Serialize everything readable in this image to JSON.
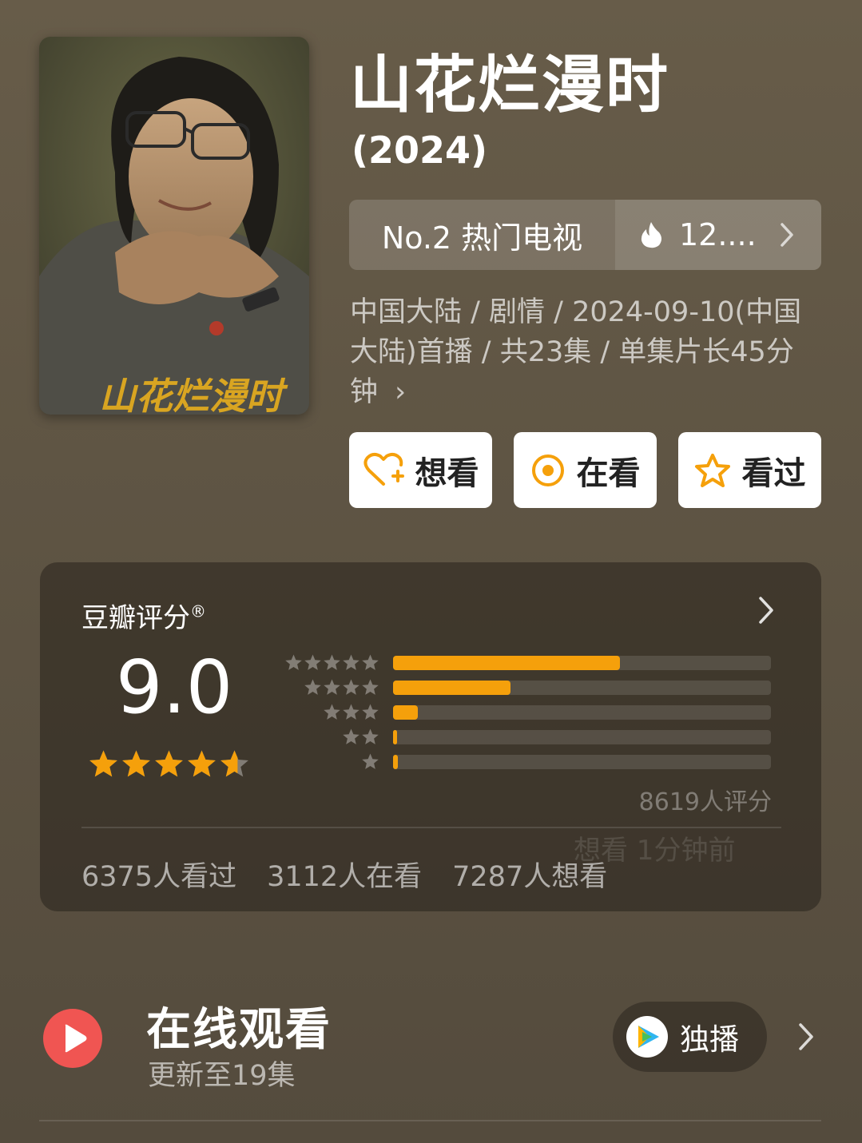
{
  "header": {
    "title": "山花烂漫时",
    "year": "(2024)",
    "poster_title_art": "山花烂漫时"
  },
  "rank": {
    "label": "No.2 热门电视",
    "heat": "12....",
    "flame_icon": "flame-icon",
    "chevron_icon": "chevron-right-icon"
  },
  "meta": {
    "text": "中国大陆 / 剧情 / 2024-09-10(中国大陆)首播 / 共23集 / 单集片长45分钟",
    "chevron": "›"
  },
  "actions": [
    {
      "label": "想看",
      "icon": "heart-plus-icon"
    },
    {
      "label": "在看",
      "icon": "target-icon"
    },
    {
      "label": "看过",
      "icon": "star-outline-icon"
    }
  ],
  "rating": {
    "title": "豆瓣评分",
    "registered": "®",
    "score": "9.0",
    "stars": 4.5,
    "distribution": [
      {
        "stars": 5,
        "fraction": 0.6
      },
      {
        "stars": 4,
        "fraction": 0.31
      },
      {
        "stars": 3,
        "fraction": 0.065
      },
      {
        "stars": 2,
        "fraction": 0.006
      },
      {
        "stars": 1,
        "fraction": 0.012
      }
    ],
    "raters": "8619人评分",
    "stats": [
      "6375人看过",
      "3112人在看",
      "7287人想看"
    ],
    "watermark": "想看 1分钟前"
  },
  "online": {
    "title": "在线观看",
    "subtitle": "更新至19集",
    "exclusive_label": "独播"
  },
  "colors": {
    "accent": "#f5a00b",
    "play_red": "#f05552",
    "button_bg": "#ffffff"
  }
}
